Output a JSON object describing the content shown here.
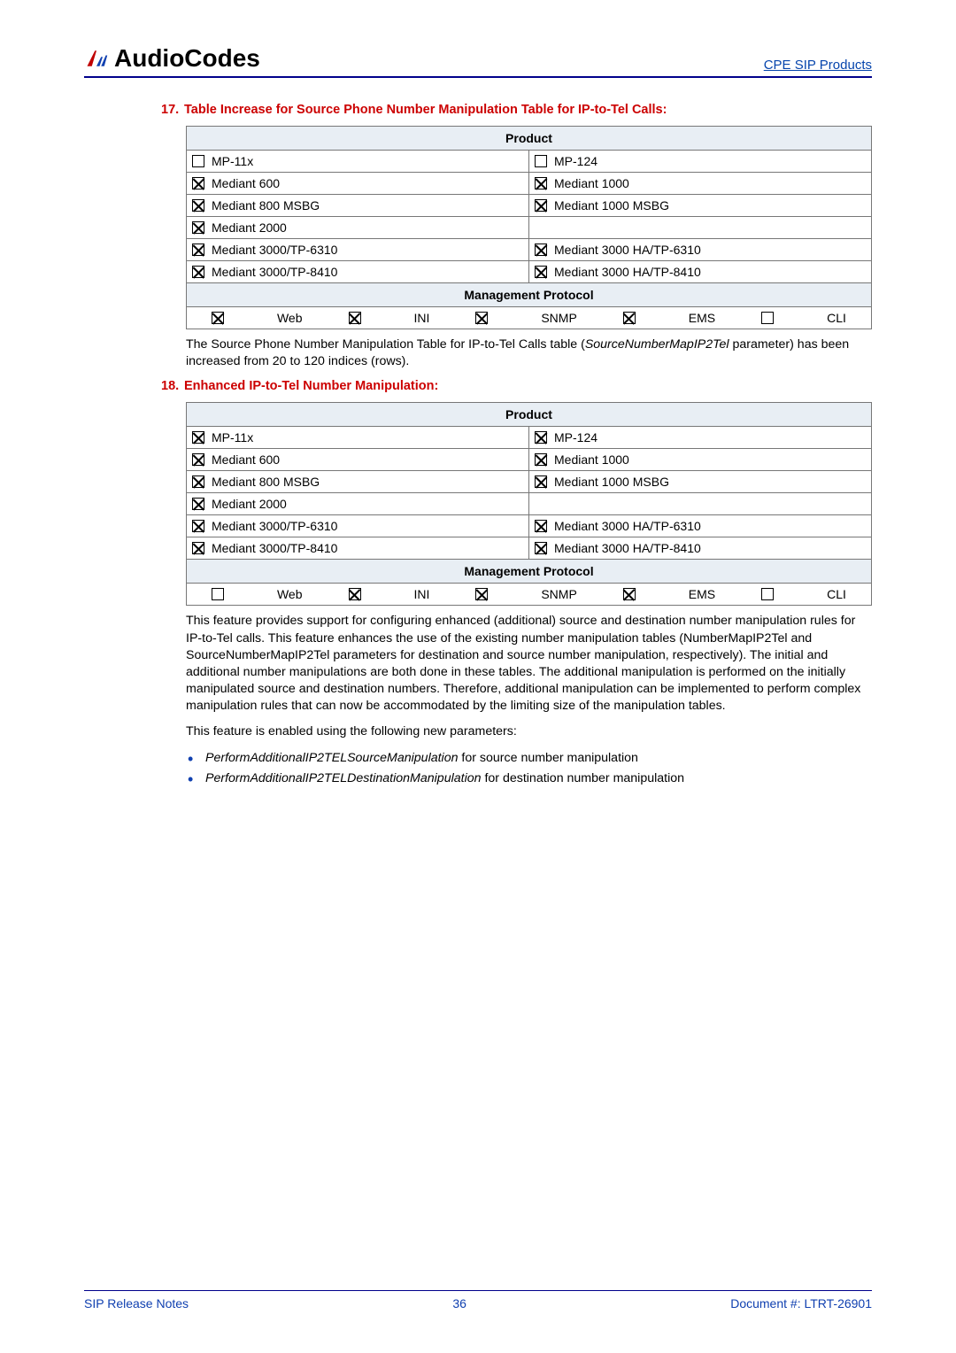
{
  "header": {
    "logo_text": "AudioCodes",
    "top_link": "CPE SIP Products"
  },
  "item17": {
    "number": "17.",
    "title": "Table Increase for Source Phone Number Manipulation Table for IP-to-Tel Calls:",
    "product_header": "Product",
    "rows": [
      {
        "l_checked": false,
        "l_label": "MP-11x",
        "r_checked": false,
        "r_label": "MP-124"
      },
      {
        "l_checked": true,
        "l_label": "Mediant 600",
        "r_checked": true,
        "r_label": "Mediant 1000"
      },
      {
        "l_checked": true,
        "l_label": "Mediant 800 MSBG",
        "r_checked": true,
        "r_label": "Mediant 1000 MSBG"
      },
      {
        "l_checked": true,
        "l_label": "Mediant 2000",
        "r_checked": null,
        "r_label": ""
      },
      {
        "l_checked": true,
        "l_label": "Mediant 3000/TP-6310",
        "r_checked": true,
        "r_label": "Mediant 3000 HA/TP-6310"
      },
      {
        "l_checked": true,
        "l_label": "Mediant 3000/TP-8410",
        "r_checked": true,
        "r_label": "Mediant 3000 HA/TP-8410"
      }
    ],
    "mgmt_header": "Management Protocol",
    "mgmt": [
      {
        "checked": true,
        "label": "Web"
      },
      {
        "checked": true,
        "label": "INI"
      },
      {
        "checked": true,
        "label": "SNMP"
      },
      {
        "checked": true,
        "label": "EMS"
      },
      {
        "checked": false,
        "label": "CLI"
      }
    ],
    "desc_pre": "The Source Phone Number Manipulation Table for IP-to-Tel Calls table (",
    "desc_param": "SourceNumberMapIP2Tel",
    "desc_post": " parameter) has been increased from 20 to 120 indices (rows)."
  },
  "item18": {
    "number": "18.",
    "title": "Enhanced IP-to-Tel Number Manipulation:",
    "product_header": "Product",
    "rows": [
      {
        "l_checked": true,
        "l_label": "MP-11x",
        "r_checked": true,
        "r_label": "MP-124"
      },
      {
        "l_checked": true,
        "l_label": "Mediant 600",
        "r_checked": true,
        "r_label": "Mediant 1000"
      },
      {
        "l_checked": true,
        "l_label": "Mediant 800 MSBG",
        "r_checked": true,
        "r_label": "Mediant 1000 MSBG"
      },
      {
        "l_checked": true,
        "l_label": "Mediant 2000",
        "r_checked": null,
        "r_label": ""
      },
      {
        "l_checked": true,
        "l_label": "Mediant 3000/TP-6310",
        "r_checked": true,
        "r_label": "Mediant 3000 HA/TP-6310"
      },
      {
        "l_checked": true,
        "l_label": "Mediant 3000/TP-8410",
        "r_checked": true,
        "r_label": "Mediant 3000 HA/TP-8410"
      }
    ],
    "mgmt_header": "Management Protocol",
    "mgmt": [
      {
        "checked": false,
        "label": "Web"
      },
      {
        "checked": true,
        "label": "INI"
      },
      {
        "checked": true,
        "label": "SNMP"
      },
      {
        "checked": true,
        "label": "EMS"
      },
      {
        "checked": false,
        "label": "CLI"
      }
    ],
    "para1": "This feature provides support for configuring enhanced (additional) source and destination number manipulation rules for IP-to-Tel calls. This feature enhances the use of the existing number manipulation tables (NumberMapIP2Tel and SourceNumberMapIP2Tel parameters for destination and source number manipulation, respectively). The initial and additional number manipulations are both done in these tables. The additional manipulation is performed on the initially manipulated source and destination numbers. Therefore, additional manipulation can be implemented to perform complex manipulation rules that can now be accommodated by the limiting size of the manipulation tables.",
    "para2": "This feature is enabled using the following new parameters:",
    "bullets": [
      {
        "param": "PerformAdditionalIP2TELSourceManipulation",
        "rest": " for source number manipulation"
      },
      {
        "param": "PerformAdditionalIP2TELDestinationManipulation",
        "rest": " for destination number manipulation"
      }
    ]
  },
  "footer": {
    "left": "SIP Release Notes",
    "center": "36",
    "right_label": "Document #",
    "right_value": ": LTRT-26901"
  }
}
